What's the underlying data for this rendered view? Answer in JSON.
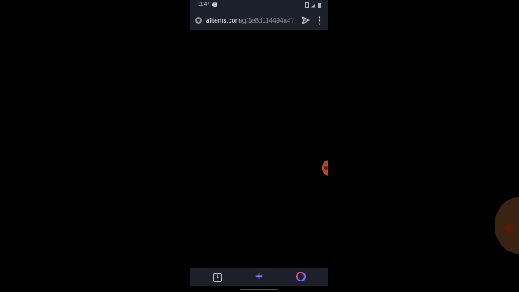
{
  "status_bar": {
    "time": "11:47",
    "alert_glyph": "!",
    "icons": [
      "notification-alert-icon",
      "vibrate-icon",
      "signal-icon",
      "battery-icon"
    ]
  },
  "address_bar": {
    "url_domain": "alitems.com",
    "url_path": "/g/1e8d114494a47",
    "icons": [
      "site-info-icon",
      "send-icon",
      "more-menu-icon"
    ]
  },
  "bottom_bar": {
    "tab_count": "1",
    "new_tab_glyph": "+",
    "icons": [
      "tabs-icon",
      "plus-icon",
      "opera-logo-icon"
    ],
    "accent_color": "#8a6cf2"
  },
  "colors": {
    "chrome_background": "#1c202a",
    "page_background": "#000000",
    "bubble_color": "#b34a22"
  }
}
